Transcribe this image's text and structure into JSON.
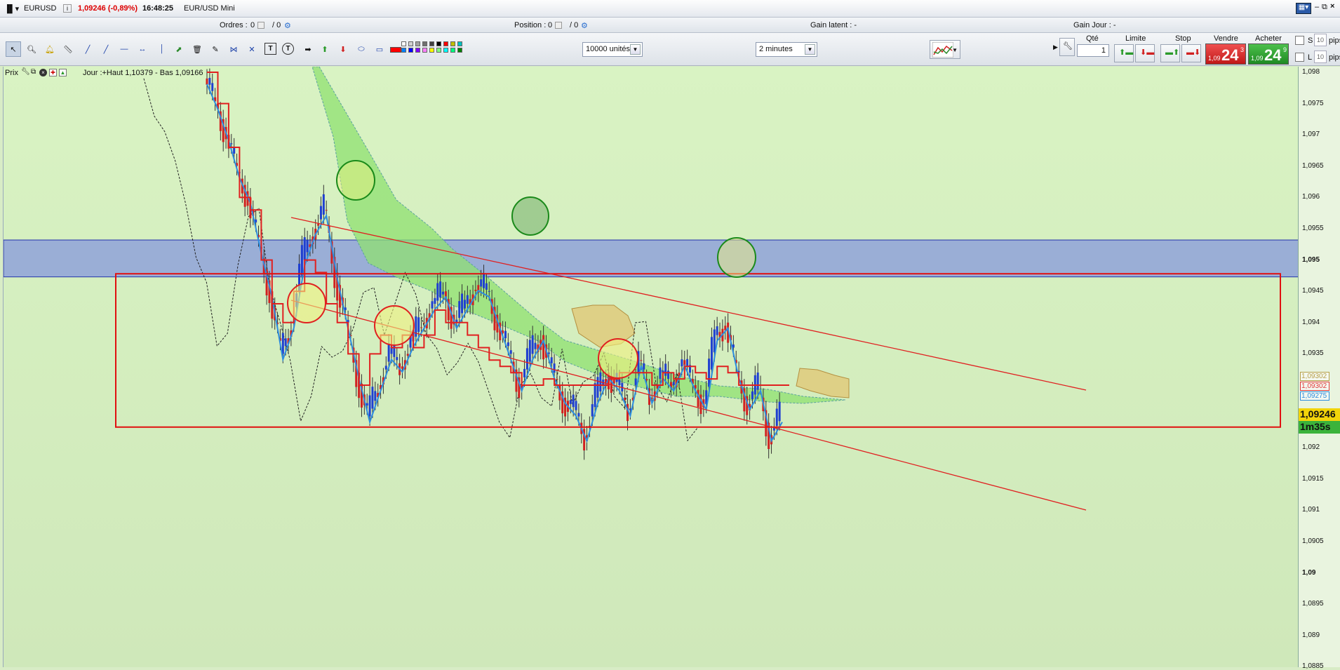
{
  "title_bar": {
    "symbol": "EURUSD",
    "price_change": "1,09246 (-0,89%)",
    "time": "16:48:25",
    "instrument": "EUR/USD Mini"
  },
  "info_row": {
    "orders_label": "Ordres :",
    "orders_value": "0",
    "orders_of": "/ 0",
    "position_label": "Position :",
    "position_value": "0",
    "position_of": "/ 0",
    "gain_latent": "Gain latent : -",
    "gain_jour": "Gain Jour : -"
  },
  "toolbar": {
    "units_value": "10000 unités",
    "timeframe_value": "2 minutes",
    "qty_label": "Qté",
    "qty_value": "1",
    "limit_label": "Limite",
    "stop_label": "Stop",
    "sell_label": "Vendre",
    "buy_label": "Acheter",
    "sell_price_small": "1,09",
    "sell_price_big": "24",
    "sell_price_sup": "3",
    "buy_price_small": "1,09",
    "buy_price_big": "24",
    "buy_price_sup": "9",
    "s_label": "S",
    "l_label": "L",
    "s_pips": "10",
    "l_pips": "10",
    "pips_label": "pips"
  },
  "colors": {
    "sell": "#e23a3a",
    "buy": "#2fa63a",
    "chart_bg": "#d6f0c4",
    "swatches": [
      "#ffffff",
      "#d0d0d0",
      "#a0a0a0",
      "#707070",
      "#404040",
      "#000000",
      "#ff0000",
      "#c0c000",
      "#00c0c0",
      "#0080ff",
      "#0000ff",
      "#8000ff",
      "#ff80ff",
      "#ffff00",
      "#80ff80",
      "#00ffff",
      "#00ff80",
      "#008000"
    ]
  },
  "chart_header": {
    "prix_label": "Prix",
    "info": "Jour :+Haut 1,10379 - Bas 1,09166"
  },
  "axis": {
    "ticks": [
      "1,098",
      "1,0975",
      "1,097",
      "1,0965",
      "1,096",
      "1,0955",
      "1,095",
      "1,0945",
      "1,094",
      "1,0935",
      "1,093",
      "1,0925",
      "1,092",
      "1,0915",
      "1,091",
      "1,0905",
      "1,09",
      "1,0895",
      "1,089",
      "1,0885"
    ],
    "bold_ticks": [
      "1,095",
      "1,09"
    ],
    "price_tags": [
      {
        "text": "1,09302",
        "color": "#b8a04a"
      },
      {
        "text": "1,09302",
        "color": "#e23a3a"
      },
      {
        "text": "1,09275",
        "color": "#2d8de0"
      }
    ],
    "current_price": "1,09246",
    "countdown": "1m35s"
  },
  "chart_data": {
    "type": "line",
    "instrument": "EURUSD",
    "ylim": [
      1.0885,
      1.098
    ],
    "price_path": [
      1.0979,
      1.0975,
      1.097,
      1.0964,
      1.096,
      1.0952,
      1.0945,
      1.0935,
      1.094,
      1.095,
      1.0955,
      1.0958,
      1.0948,
      1.094,
      1.0932,
      1.0925,
      1.093,
      1.0935,
      1.0933,
      1.0937,
      1.094,
      1.0943,
      1.0945,
      1.094,
      1.0943,
      1.0946,
      1.0945,
      1.094,
      1.0935,
      1.093,
      1.0935,
      1.0938,
      1.0932,
      1.0928,
      1.0926,
      1.0922,
      1.0928,
      1.0932,
      1.093,
      1.0926,
      1.0934,
      1.0928,
      1.0932,
      1.093,
      1.0934,
      1.093,
      1.0927,
      1.0938,
      1.094,
      1.0932,
      1.0927,
      1.093,
      1.0922,
      1.0925
    ],
    "kijun": [
      1.098,
      1.0975,
      1.0968,
      1.096,
      1.0958,
      1.095,
      1.0943,
      1.094,
      1.0945,
      1.095,
      1.0948,
      1.0943,
      1.094,
      1.0935,
      1.093,
      1.0935,
      1.0938,
      1.0936,
      1.0938,
      1.0936,
      1.0938,
      1.0942,
      1.094,
      1.094,
      1.0938,
      1.0936,
      1.0934,
      1.0933,
      1.0932,
      1.093,
      1.093,
      1.0931,
      1.093,
      1.093,
      1.093,
      1.093,
      1.093,
      1.0931,
      1.0932,
      1.0932,
      1.0932,
      1.093,
      1.0932,
      1.0931,
      1.0933,
      1.0932,
      1.0931,
      1.0933,
      1.0932,
      1.093,
      1.093,
      1.093,
      1.093,
      1.093
    ],
    "resistance_zone": [
      1.09473,
      1.09532
    ],
    "range_box": [
      1.09233,
      1.09478
    ]
  }
}
